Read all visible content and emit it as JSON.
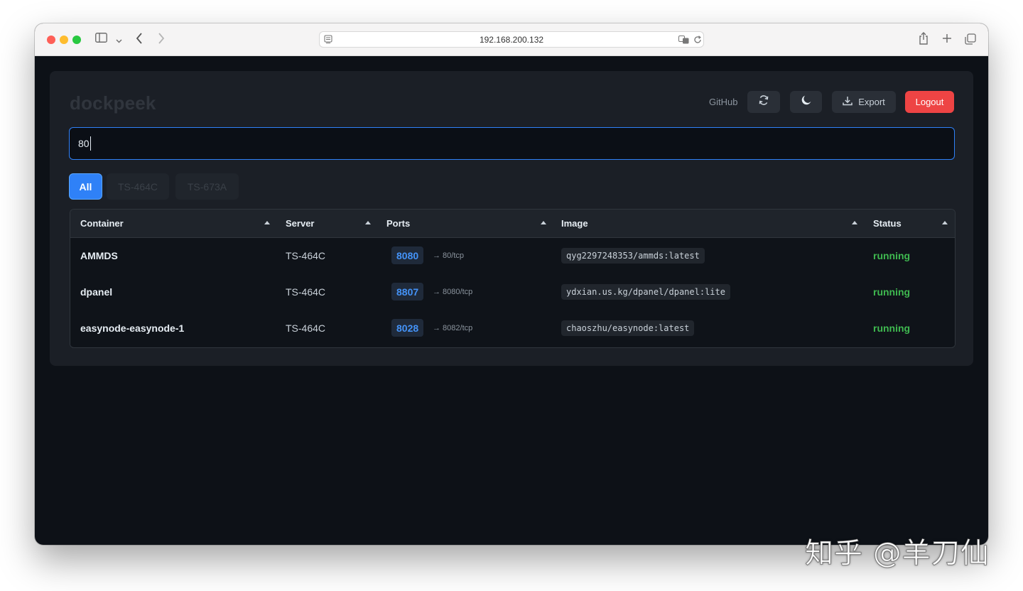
{
  "browser": {
    "url": "192.168.200.132"
  },
  "header": {
    "brand": "dockpeek",
    "github_label": "GitHub",
    "export_label": "Export",
    "logout_label": "Logout"
  },
  "search": {
    "value": "80"
  },
  "tabs": [
    {
      "label": "All",
      "active": true
    },
    {
      "label": "TS-464C",
      "active": false
    },
    {
      "label": "TS-673A",
      "active": false
    }
  ],
  "table": {
    "columns": [
      "Container",
      "Server",
      "Ports",
      "Image",
      "Status"
    ],
    "rows": [
      {
        "container": "AMMDS",
        "server": "TS-464C",
        "port": "8080",
        "port_map": "→ 80/tcp",
        "image": "qyg2297248353/ammds:latest",
        "status": "running"
      },
      {
        "container": "dpanel",
        "server": "TS-464C",
        "port": "8807",
        "port_map": "→ 8080/tcp",
        "image": "ydxian.us.kg/dpanel/dpanel:lite",
        "status": "running"
      },
      {
        "container": "easynode-easynode-1",
        "server": "TS-464C",
        "port": "8028",
        "port_map": "→ 8082/tcp",
        "image": "chaoszhu/easynode:latest",
        "status": "running"
      }
    ]
  },
  "watermark": "知乎 @羊刀仙",
  "colors": {
    "accent": "#2f81f7",
    "logout": "#ee4444",
    "status_running": "#3fb950",
    "port_link": "#4493f8"
  }
}
